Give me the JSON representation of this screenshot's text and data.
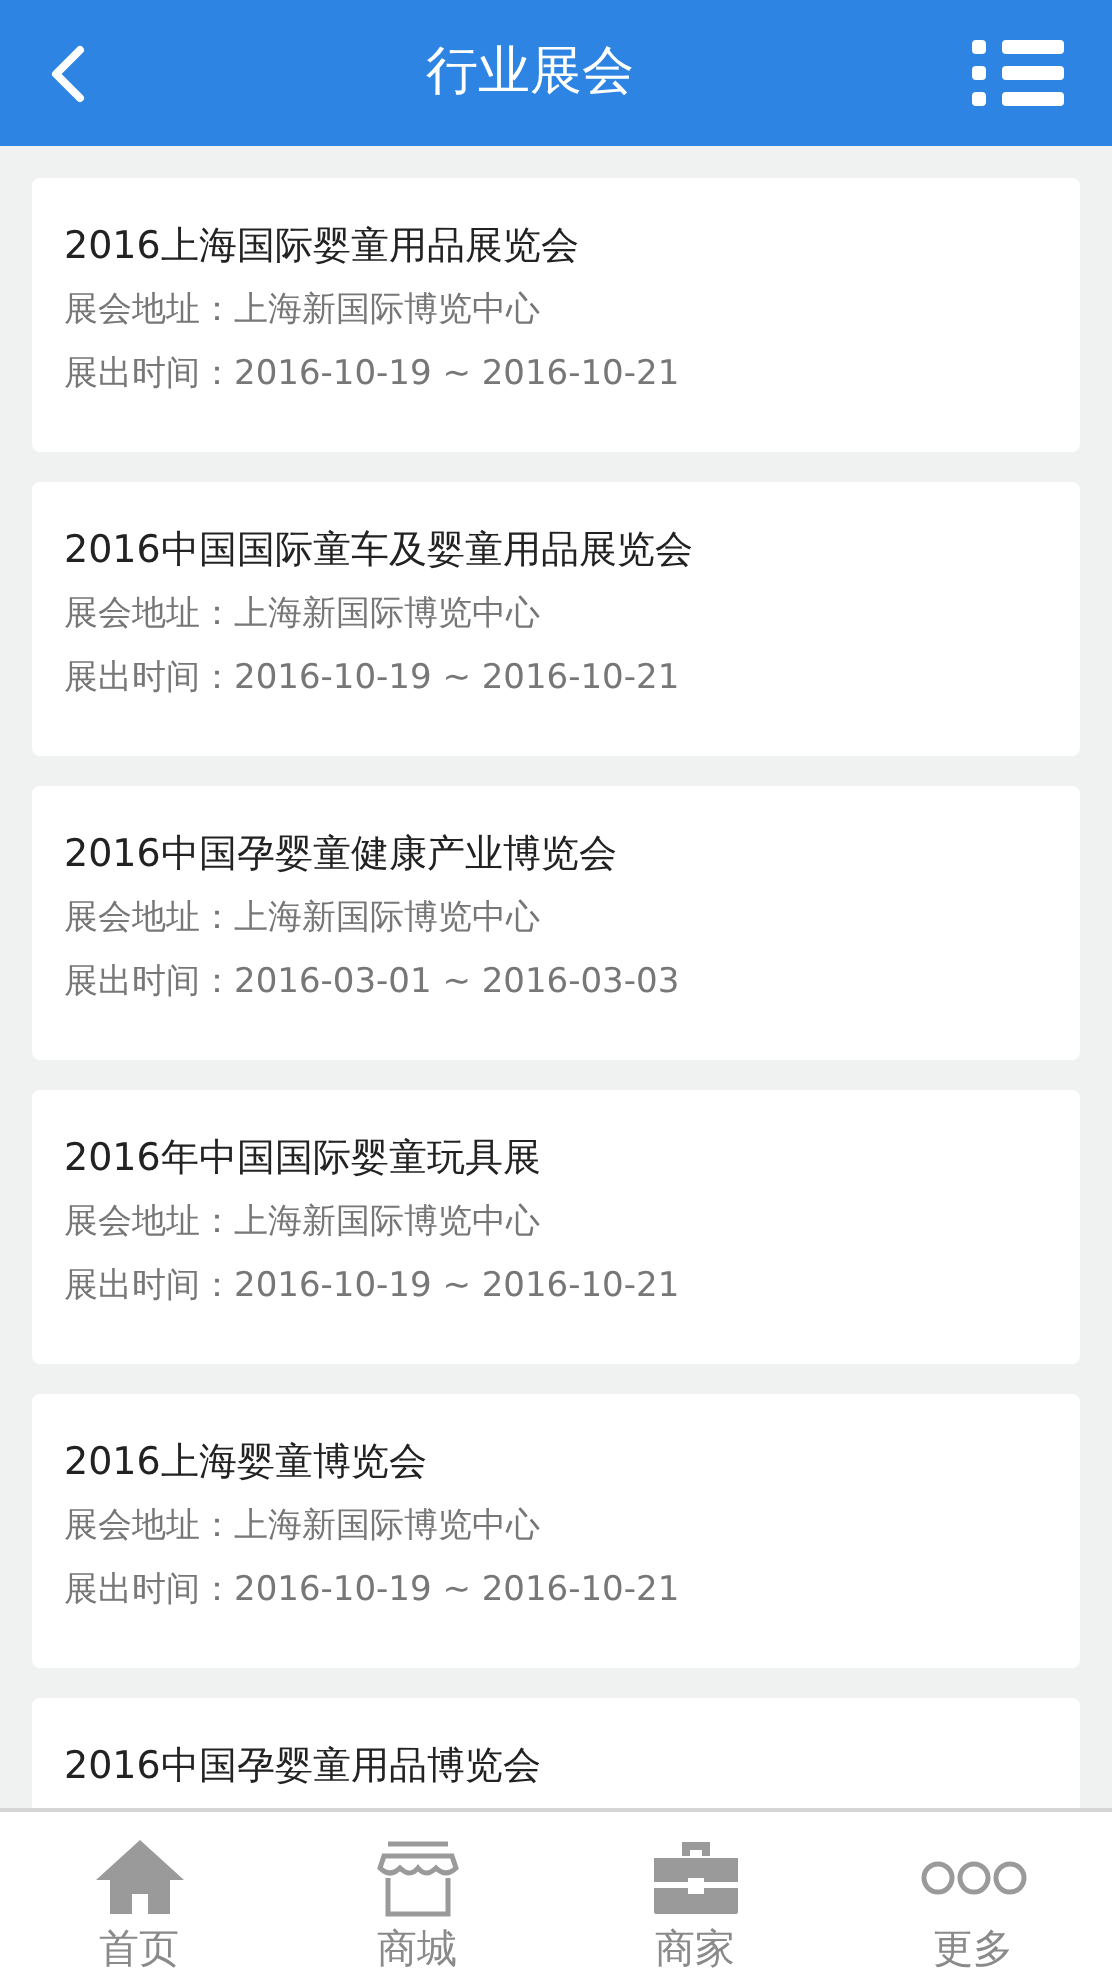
{
  "header": {
    "title": "行业展会"
  },
  "exhibitions": [
    {
      "title": "2016上海国际婴童用品展览会",
      "address": "展会地址：上海新国际博览中心",
      "time": "展出时间：2016-10-19 ~ 2016-10-21"
    },
    {
      "title": "2016中国国际童车及婴童用品展览会",
      "address": "展会地址：上海新国际博览中心",
      "time": "展出时间：2016-10-19 ~ 2016-10-21"
    },
    {
      "title": "2016中国孕婴童健康产业博览会",
      "address": "展会地址：上海新国际博览中心",
      "time": "展出时间：2016-03-01 ~ 2016-03-03"
    },
    {
      "title": "2016年中国国际婴童玩具展",
      "address": "展会地址：上海新国际博览中心",
      "time": "展出时间：2016-10-19 ~ 2016-10-21"
    },
    {
      "title": "2016上海婴童博览会",
      "address": "展会地址：上海新国际博览中心",
      "time": "展出时间：2016-10-19 ~ 2016-10-21"
    },
    {
      "title": "2016中国孕婴童用品博览会"
    }
  ],
  "bottom_nav": [
    {
      "kind": "home",
      "label": "首页"
    },
    {
      "kind": "shop",
      "label": "商城"
    },
    {
      "kind": "briefcase",
      "label": "商家"
    },
    {
      "kind": "more",
      "label": "更多"
    }
  ]
}
